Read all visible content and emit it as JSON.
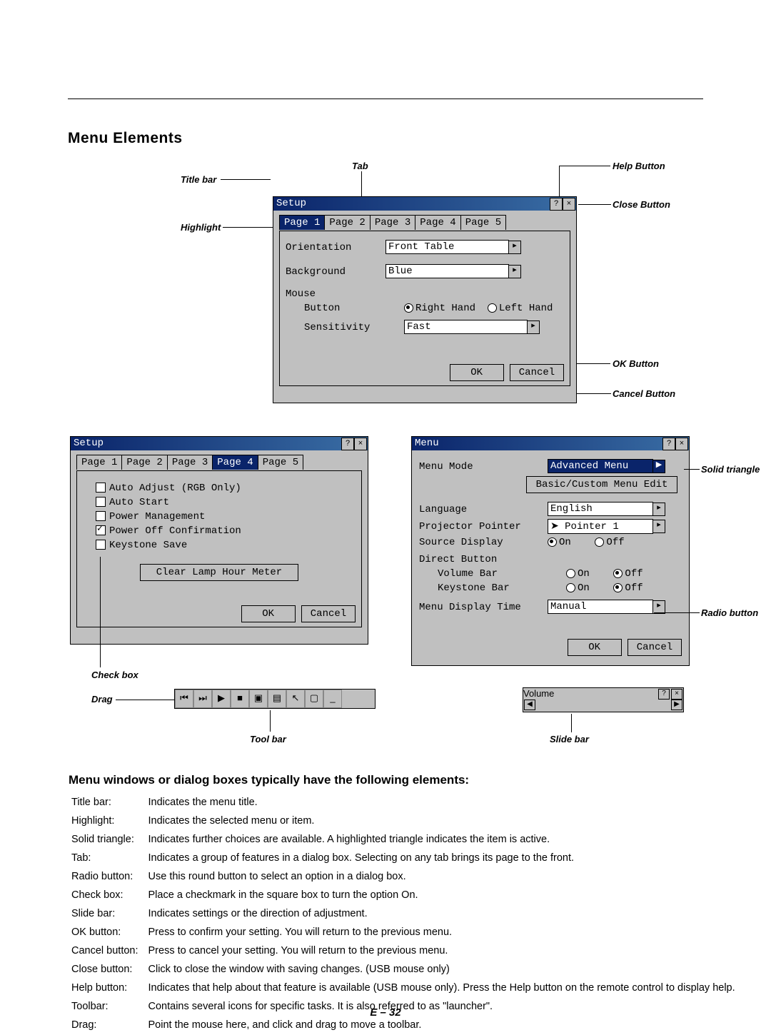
{
  "heading": "Menu Elements",
  "labels": {
    "titlebar": "Title bar",
    "tab": "Tab",
    "helpBtn": "Help Button",
    "closeBtn": "Close Button",
    "highlight": "Highlight",
    "okBtn": "OK Button",
    "cancelBtn": "Cancel Button",
    "checkbox": "Check box",
    "drag": "Drag",
    "toolbar": "Tool bar",
    "slidebar": "Slide bar",
    "solidTriangle": "Solid triangle",
    "radioBtn": "Radio button"
  },
  "setup1": {
    "title": "Setup",
    "tabs": [
      "Page 1",
      "Page 2",
      "Page 3",
      "Page 4",
      "Page 5"
    ],
    "selected": 0,
    "orientation_l": "Orientation",
    "orientation_v": "Front Table",
    "background_l": "Background",
    "background_v": "Blue",
    "mouse_l": "Mouse",
    "button_l": "Button",
    "button_right": "Right Hand",
    "button_left": "Left Hand",
    "sensitivity_l": "Sensitivity",
    "sensitivity_v": "Fast",
    "ok": "OK",
    "cancel": "Cancel"
  },
  "setup2": {
    "title": "Setup",
    "tabs": [
      "Page 1",
      "Page 2",
      "Page 3",
      "Page 4",
      "Page 5"
    ],
    "selected": 3,
    "c0": "Auto Adjust (RGB Only)",
    "c1": "Auto Start",
    "c2": "Power Management",
    "c3": "Power Off Confirmation",
    "c4": "Keystone Save",
    "clear": "Clear Lamp Hour Meter",
    "ok": "OK",
    "cancel": "Cancel"
  },
  "menu": {
    "title": "Menu",
    "mode_l": "Menu Mode",
    "mode_v": "Advanced Menu",
    "edit": "Basic/Custom Menu Edit",
    "lang_l": "Language",
    "lang_v": "English",
    "pointer_l": "Projector Pointer",
    "pointer_v": "Pointer 1",
    "source_l": "Source Display",
    "direct_l": "Direct Button",
    "vol_l": "Volume Bar",
    "key_l": "Keystone Bar",
    "time_l": "Menu Display Time",
    "time_v": "Manual",
    "on": "On",
    "off": "Off",
    "ok": "OK",
    "cancel": "Cancel"
  },
  "volume": {
    "title": "Volume"
  },
  "section2": "Menu windows or dialog boxes typically have the following elements:",
  "desc": [
    [
      "Title bar:",
      "Indicates the menu title."
    ],
    [
      "Highlight:",
      "Indicates the selected menu or item."
    ],
    [
      "Solid triangle:",
      "Indicates further choices are available. A highlighted triangle indicates the item is active."
    ],
    [
      "Tab:",
      "Indicates a group of features in a dialog box. Selecting on any tab brings its page to the front."
    ],
    [
      "Radio button:",
      "Use this round button to select an option in a dialog box."
    ],
    [
      "Check box:",
      "Place a checkmark in the square box to turn the option On."
    ],
    [
      "Slide bar:",
      "Indicates settings or the direction of adjustment."
    ],
    [
      "OK button:",
      "Press to confirm your setting. You will return to the previous menu."
    ],
    [
      "Cancel button:",
      "Press to cancel your setting. You will return to the previous menu."
    ],
    [
      "Close button:",
      "Click to close the window with saving changes. (USB mouse only)"
    ],
    [
      "Help button:",
      "Indicates that help about that feature is available (USB mouse only). Press the Help button on the remote control to display help."
    ],
    [
      "Toolbar:",
      "Contains several icons for specific tasks. It is also referred to as \"launcher\"."
    ],
    [
      "Drag:",
      "Point the mouse here, and click and drag to move a toolbar."
    ]
  ],
  "footer": "E – 32"
}
